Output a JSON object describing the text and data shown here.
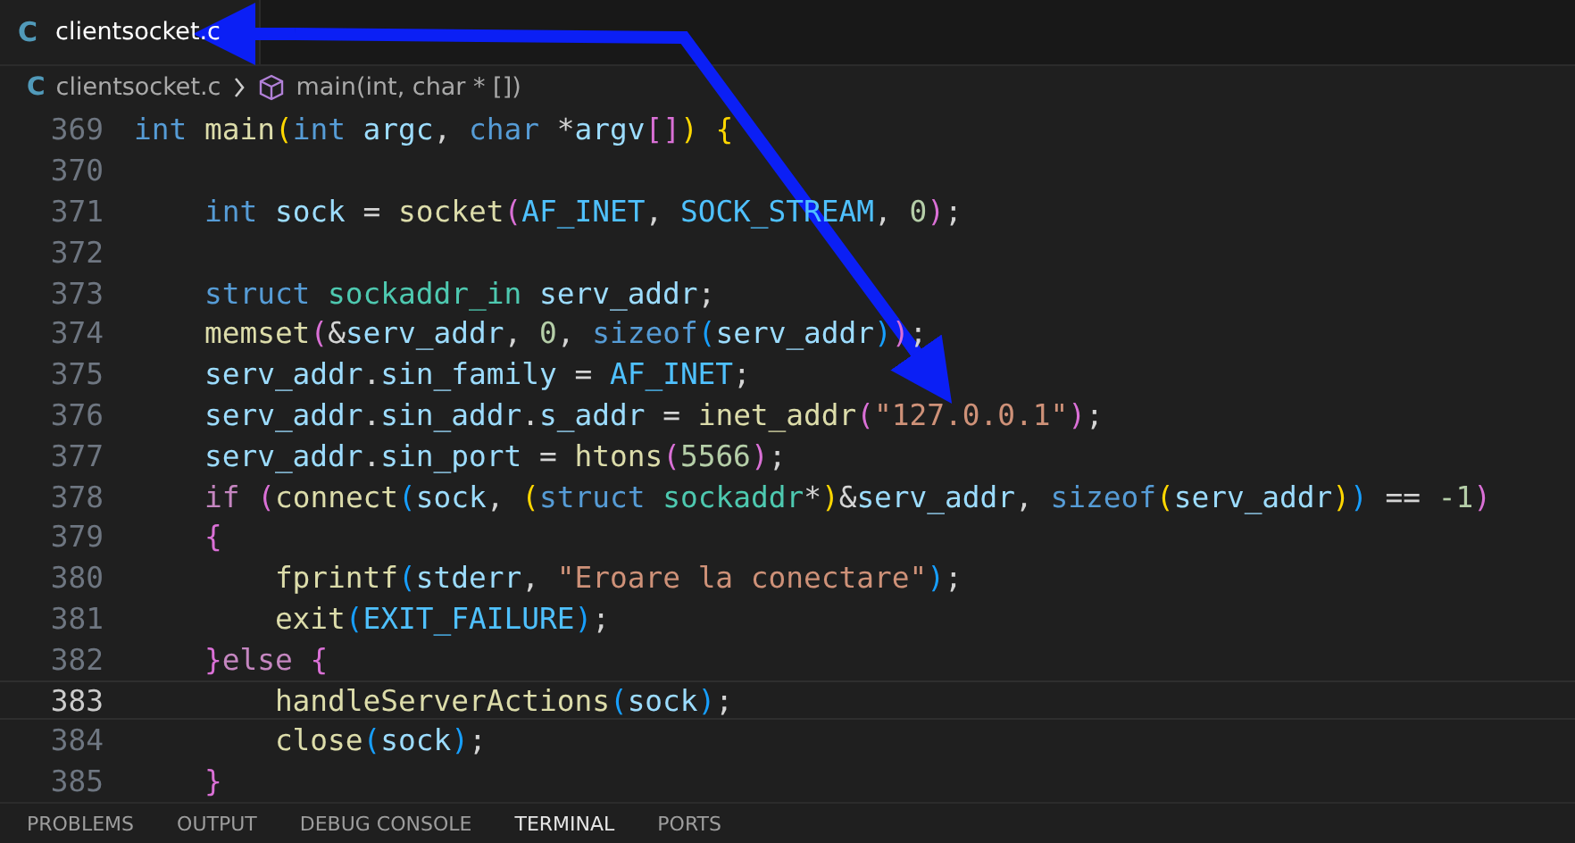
{
  "tab": {
    "icon": "C",
    "label": "clientsocket.c",
    "selected": true
  },
  "breadcrumb": {
    "file_icon": "C",
    "file": "clientsocket.c",
    "symbol": "main(int, char * [])"
  },
  "lines": [
    {
      "number": "369",
      "current": false,
      "tokens": [
        {
          "kind": "type",
          "text": "int"
        },
        {
          "kind": "func",
          "text": " main"
        },
        {
          "kind": "b1",
          "text": "("
        },
        {
          "kind": "type",
          "text": "int"
        },
        {
          "kind": "var",
          "text": " argc"
        },
        {
          "kind": "plain",
          "text": ", "
        },
        {
          "kind": "type",
          "text": "char"
        },
        {
          "kind": "plain",
          "text": " *"
        },
        {
          "kind": "var",
          "text": "argv"
        },
        {
          "kind": "b2",
          "text": "[]"
        },
        {
          "kind": "b1",
          "text": ")"
        },
        {
          "kind": "b1",
          "text": " {"
        }
      ]
    },
    {
      "number": "370",
      "current": false
    },
    {
      "number": "371",
      "current": false,
      "tokens": [
        {
          "kind": "type",
          "text": "    int"
        },
        {
          "kind": "var",
          "text": " sock"
        },
        {
          "kind": "plain",
          "text": " = "
        },
        {
          "kind": "func",
          "text": "socket"
        },
        {
          "kind": "b2",
          "text": "("
        },
        {
          "kind": "macro",
          "text": "AF_INET"
        },
        {
          "kind": "plain",
          "text": ", "
        },
        {
          "kind": "macro",
          "text": "SOCK_STREAM"
        },
        {
          "kind": "plain",
          "text": ", "
        },
        {
          "kind": "number",
          "text": "0"
        },
        {
          "kind": "b2",
          "text": ")"
        },
        {
          "kind": "plain",
          "text": ";"
        }
      ]
    },
    {
      "number": "372",
      "current": false
    },
    {
      "number": "373",
      "current": false,
      "tokens": [
        {
          "kind": "type",
          "text": "    struct"
        },
        {
          "kind": "cls",
          "text": " sockaddr_in"
        },
        {
          "kind": "var",
          "text": " serv_addr"
        },
        {
          "kind": "plain",
          "text": ";"
        }
      ]
    },
    {
      "number": "374",
      "current": false,
      "tokens": [
        {
          "kind": "func",
          "text": "    memset"
        },
        {
          "kind": "b2",
          "text": "("
        },
        {
          "kind": "plain",
          "text": "&"
        },
        {
          "kind": "var",
          "text": "serv_addr"
        },
        {
          "kind": "plain",
          "text": ", "
        },
        {
          "kind": "number",
          "text": "0"
        },
        {
          "kind": "plain",
          "text": ", "
        },
        {
          "kind": "type",
          "text": "sizeof"
        },
        {
          "kind": "b3",
          "text": "("
        },
        {
          "kind": "var",
          "text": "serv_addr"
        },
        {
          "kind": "b3",
          "text": ")"
        },
        {
          "kind": "b2",
          "text": ")"
        },
        {
          "kind": "plain",
          "text": ";"
        }
      ]
    },
    {
      "number": "375",
      "current": false,
      "tokens": [
        {
          "kind": "var",
          "text": "    serv_addr"
        },
        {
          "kind": "plain",
          "text": "."
        },
        {
          "kind": "var",
          "text": "sin_family"
        },
        {
          "kind": "plain",
          "text": " = "
        },
        {
          "kind": "macro",
          "text": "AF_INET"
        },
        {
          "kind": "plain",
          "text": ";"
        }
      ]
    },
    {
      "number": "376",
      "current": false,
      "tokens": [
        {
          "kind": "var",
          "text": "    serv_addr"
        },
        {
          "kind": "plain",
          "text": "."
        },
        {
          "kind": "var",
          "text": "sin_addr"
        },
        {
          "kind": "plain",
          "text": "."
        },
        {
          "kind": "var",
          "text": "s_addr"
        },
        {
          "kind": "plain",
          "text": " = "
        },
        {
          "kind": "func",
          "text": "inet_addr"
        },
        {
          "kind": "b2",
          "text": "("
        },
        {
          "kind": "string",
          "text": "\"127.0.0.1\""
        },
        {
          "kind": "b2",
          "text": ")"
        },
        {
          "kind": "plain",
          "text": ";"
        }
      ]
    },
    {
      "number": "377",
      "current": false,
      "tokens": [
        {
          "kind": "var",
          "text": "    serv_addr"
        },
        {
          "kind": "plain",
          "text": "."
        },
        {
          "kind": "var",
          "text": "sin_port"
        },
        {
          "kind": "plain",
          "text": " = "
        },
        {
          "kind": "func",
          "text": "htons"
        },
        {
          "kind": "b2",
          "text": "("
        },
        {
          "kind": "number",
          "text": "5566"
        },
        {
          "kind": "b2",
          "text": ")"
        },
        {
          "kind": "plain",
          "text": ";"
        }
      ]
    },
    {
      "number": "378",
      "current": false,
      "tokens": [
        {
          "kind": "ctrl",
          "text": "    if"
        },
        {
          "kind": "b2",
          "text": " ("
        },
        {
          "kind": "func",
          "text": "connect"
        },
        {
          "kind": "b3",
          "text": "("
        },
        {
          "kind": "var",
          "text": "sock"
        },
        {
          "kind": "plain",
          "text": ", "
        },
        {
          "kind": "b1",
          "text": "("
        },
        {
          "kind": "type",
          "text": "struct"
        },
        {
          "kind": "cls",
          "text": " sockaddr"
        },
        {
          "kind": "plain",
          "text": "*"
        },
        {
          "kind": "b1",
          "text": ")"
        },
        {
          "kind": "plain",
          "text": "&"
        },
        {
          "kind": "var",
          "text": "serv_addr"
        },
        {
          "kind": "plain",
          "text": ", "
        },
        {
          "kind": "type",
          "text": "sizeof"
        },
        {
          "kind": "b1",
          "text": "("
        },
        {
          "kind": "var",
          "text": "serv_addr"
        },
        {
          "kind": "b1",
          "text": ")"
        },
        {
          "kind": "b3",
          "text": ")"
        },
        {
          "kind": "plain",
          "text": " == "
        },
        {
          "kind": "number",
          "text": "-1"
        },
        {
          "kind": "b2",
          "text": ")"
        }
      ]
    },
    {
      "number": "379",
      "current": false,
      "tokens": [
        {
          "kind": "b2",
          "text": "    {"
        }
      ]
    },
    {
      "number": "380",
      "current": false,
      "tokens": [
        {
          "kind": "func",
          "text": "        fprintf"
        },
        {
          "kind": "b3",
          "text": "("
        },
        {
          "kind": "var",
          "text": "stderr"
        },
        {
          "kind": "plain",
          "text": ", "
        },
        {
          "kind": "string",
          "text": "\"Eroare la conectare\""
        },
        {
          "kind": "b3",
          "text": ")"
        },
        {
          "kind": "plain",
          "text": ";"
        }
      ]
    },
    {
      "number": "381",
      "current": false,
      "tokens": [
        {
          "kind": "func",
          "text": "        exit"
        },
        {
          "kind": "b3",
          "text": "("
        },
        {
          "kind": "macro",
          "text": "EXIT_FAILURE"
        },
        {
          "kind": "b3",
          "text": ")"
        },
        {
          "kind": "plain",
          "text": ";"
        }
      ]
    },
    {
      "number": "382",
      "current": false,
      "tokens": [
        {
          "kind": "b2",
          "text": "    }"
        },
        {
          "kind": "ctrl",
          "text": "else"
        },
        {
          "kind": "b2",
          "text": " {"
        }
      ]
    },
    {
      "number": "383",
      "current": true,
      "tokens": [
        {
          "kind": "func",
          "text": "        handleServerActions"
        },
        {
          "kind": "b3",
          "text": "("
        },
        {
          "kind": "var",
          "text": "sock"
        },
        {
          "kind": "b3",
          "text": ")"
        },
        {
          "kind": "plain",
          "text": ";"
        }
      ]
    },
    {
      "number": "384",
      "current": false,
      "tokens": [
        {
          "kind": "func",
          "text": "        close"
        },
        {
          "kind": "b3",
          "text": "("
        },
        {
          "kind": "var",
          "text": "sock"
        },
        {
          "kind": "b3",
          "text": ")"
        },
        {
          "kind": "plain",
          "text": ";"
        }
      ]
    },
    {
      "number": "385",
      "current": false,
      "tokens": [
        {
          "kind": "b2",
          "text": "    }"
        }
      ]
    }
  ],
  "panel_tabs": [
    {
      "label": "PROBLEMS",
      "selected": false
    },
    {
      "label": "OUTPUT",
      "selected": false
    },
    {
      "label": "DEBUG CONSOLE",
      "selected": false
    },
    {
      "label": "TERMINAL",
      "selected": true
    },
    {
      "label": "PORTS",
      "selected": false
    }
  ]
}
